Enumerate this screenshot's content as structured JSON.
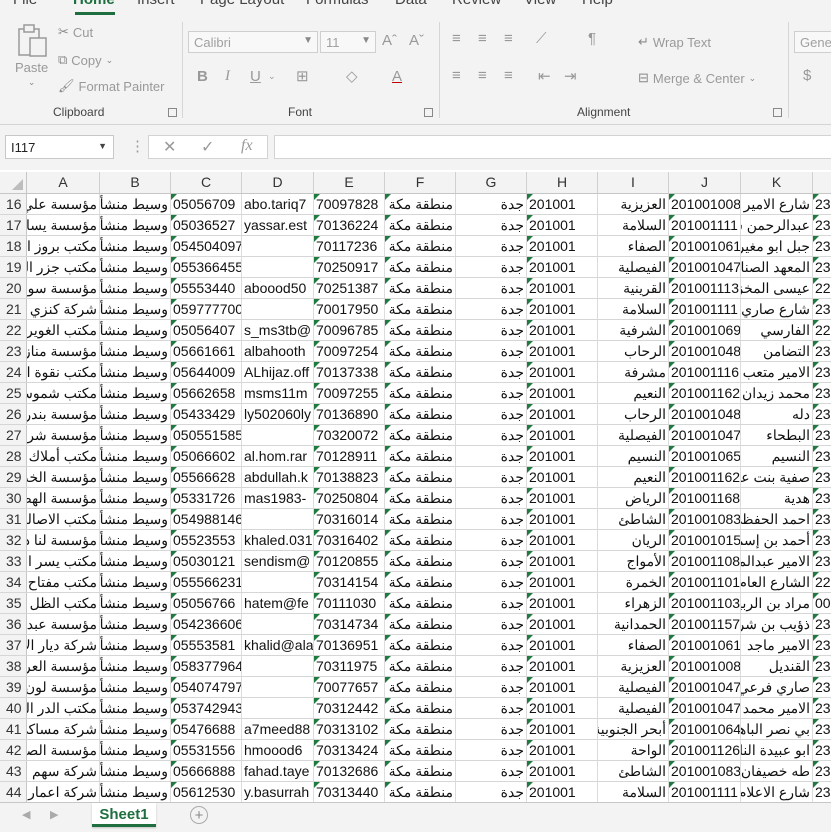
{
  "ribbon_tabs": [
    "File",
    "Home",
    "Insert",
    "Page Layout",
    "Formulas",
    "Data",
    "Review",
    "View",
    "Help"
  ],
  "clipboard": {
    "paste": "Paste",
    "cut": "Cut",
    "copy": "Copy",
    "format_painter": "Format Painter",
    "label": "Clipboard"
  },
  "font": {
    "name": "Calibri",
    "size": "11",
    "label": "Font",
    "bold": "B",
    "italic": "I",
    "underline": "U",
    "grow": "Aˆ",
    "shrink": "Aˇ",
    "font_color": "A"
  },
  "alignment": {
    "wrap_text": "Wrap Text",
    "merge_center": "Merge & Center",
    "label": "Alignment"
  },
  "number": {
    "format": "Gene",
    "currency": "$"
  },
  "name_box": "I117",
  "formula_fx": "fx",
  "columns": [
    "A",
    "B",
    "C",
    "D",
    "E",
    "F",
    "G",
    "H",
    "I",
    "J",
    "K"
  ],
  "rows": [
    {
      "num": "16",
      "a": "مؤسسة علي",
      "b": "وسيط منشأة",
      "c": "05056709",
      "d": "abo.tariq7",
      "e": "70097828",
      "f": "منطقة مكة الـ",
      "g": "جدة",
      "h": "201001",
      "i": "العزيزية",
      "j": "201001008",
      "k": "شارع الامير م",
      "l": "23"
    },
    {
      "num": "17",
      "a": "مؤسسة يسار",
      "b": "وسيط منشأة",
      "c": "05036527",
      "d": "yassar.est",
      "e": "70136224",
      "f": "منطقة مكة الـ",
      "g": "جدة",
      "h": "201001",
      "i": "السلامة",
      "j": "201001111",
      "k": "عبدالرحمن ش",
      "l": "23"
    },
    {
      "num": "18",
      "a": "مكتب بروز الـ",
      "b": "وسيط منشأة",
      "c": "0545040973",
      "d": "",
      "e": "70117236",
      "f": "منطقة مكة الـ",
      "g": "جدة",
      "h": "201001",
      "i": "الصفاء",
      "j": "201001061",
      "k": "جبل ابو مغير",
      "l": "23"
    },
    {
      "num": "19",
      "a": "مكتب جزر الـ",
      "b": "وسيط منشأة",
      "c": "0553664552",
      "d": "",
      "e": "70250917",
      "f": "منطقة مكة الـ",
      "g": "جدة",
      "h": "201001",
      "i": "الفيصلية",
      "j": "201001047",
      "k": "المعهد الصنا",
      "l": "23"
    },
    {
      "num": "20",
      "a": "مؤسسة سواء",
      "b": "وسيط منشأة",
      "c": "05553440",
      "d": "aboood50",
      "e": "70251387",
      "f": "منطقة مكة الـ",
      "g": "جدة",
      "h": "201001",
      "i": "القرينية",
      "j": "201001113",
      "k": "عيسى المخزو",
      "l": "22"
    },
    {
      "num": "21",
      "a": "شركة كنزي الـ",
      "b": "وسيط منشأة",
      "c": "0597777008",
      "d": "",
      "e": "70017950",
      "f": "منطقة مكة الـ",
      "g": "جدة",
      "h": "201001",
      "i": "السلامة",
      "j": "201001111",
      "k": "شارع صاري",
      "l": "23"
    },
    {
      "num": "22",
      "a": "مكتب الغويري",
      "b": "وسيط منشأة",
      "c": "05056407",
      "d": "s_ms3tb@",
      "e": "70096785",
      "f": "منطقة مكة الـ",
      "g": "جدة",
      "h": "201001",
      "i": "الشرفية",
      "j": "201001069",
      "k": "الفارسي",
      "l": "22"
    },
    {
      "num": "23",
      "a": "مؤسسة منازل",
      "b": "وسيط منشأة",
      "c": "05661661",
      "d": "albahooth",
      "e": "70097254",
      "f": "منطقة مكة الـ",
      "g": "جدة",
      "h": "201001",
      "i": "الرحاب",
      "j": "201001048",
      "k": "التضامن",
      "l": "23"
    },
    {
      "num": "24",
      "a": "مكتب نقوة الـ",
      "b": "وسيط منشأة",
      "c": "05644009",
      "d": "ALhijaz.off",
      "e": "70137338",
      "f": "منطقة مكة الـ",
      "g": "جدة",
      "h": "201001",
      "i": "مشرفة",
      "j": "201001116",
      "k": "الامير متعب",
      "l": "23"
    },
    {
      "num": "25",
      "a": "مكتب شموس",
      "b": "وسيط منشأة",
      "c": "05662658",
      "d": "msms11m",
      "e": "70097255",
      "f": "منطقة مكة الـ",
      "g": "جدة",
      "h": "201001",
      "i": "النعيم",
      "j": "201001162",
      "k": "محمد زيدان",
      "l": "23"
    },
    {
      "num": "26",
      "a": "مؤسسة بندر",
      "b": "وسيط منشأة",
      "c": "05433429",
      "d": "ly502060ly",
      "e": "70136890",
      "f": "منطقة مكة الـ",
      "g": "جدة",
      "h": "201001",
      "i": "الرحاب",
      "j": "201001048",
      "k": "دله",
      "l": "23"
    },
    {
      "num": "27",
      "a": "مؤسسة شرق",
      "b": "وسيط منشأة",
      "c": "0505515851",
      "d": "",
      "e": "70320072",
      "f": "منطقة مكة الـ",
      "g": "جدة",
      "h": "201001",
      "i": "الفيصلية",
      "j": "201001047",
      "k": "البطحاء",
      "l": "23"
    },
    {
      "num": "28",
      "a": "مكتب أملاك",
      "b": "وسيط منشأة",
      "c": "05066602",
      "d": "al.hom.rar",
      "e": "70128911",
      "f": "منطقة مكة الـ",
      "g": "جدة",
      "h": "201001",
      "i": "النسيم",
      "j": "201001065",
      "k": "النسيم",
      "l": "23"
    },
    {
      "num": "29",
      "a": "مؤسسة الخد",
      "b": "وسيط منشأة",
      "c": "05566628",
      "d": "abdullah.k",
      "e": "70138823",
      "f": "منطقة مكة الـ",
      "g": "جدة",
      "h": "201001",
      "i": "النعيم",
      "j": "201001162",
      "k": "صفية بنت عـ",
      "l": "23"
    },
    {
      "num": "30",
      "a": "مؤسسة الهض",
      "b": "وسيط منشأة",
      "c": "05331726",
      "d": "mas1983-",
      "e": "70250804",
      "f": "منطقة مكة الـ",
      "g": "جدة",
      "h": "201001",
      "i": "الرياض",
      "j": "201001168",
      "k": "هدية",
      "l": "23"
    },
    {
      "num": "31",
      "a": "مكتب الاصالـ",
      "b": "وسيط منشأة",
      "c": "0549881463",
      "d": "",
      "e": "70316014",
      "f": "منطقة مكة الـ",
      "g": "جدة",
      "h": "201001",
      "i": "الشاطئ",
      "j": "201001083",
      "k": "احمد الحفظي",
      "l": "23"
    },
    {
      "num": "32",
      "a": "مؤسسة لنا دا",
      "b": "وسيط منشأة",
      "c": "05523553",
      "d": "khaled.031",
      "e": "70316402",
      "f": "منطقة مكة الـ",
      "g": "جدة",
      "h": "201001",
      "i": "الريان",
      "j": "201001015",
      "k": "أحمد بن إسم",
      "l": "23"
    },
    {
      "num": "33",
      "a": "مكتب يسر الـ",
      "b": "وسيط منشأة",
      "c": "05030121",
      "d": "sendism@",
      "e": "70120855",
      "f": "منطقة مكة الـ",
      "g": "جدة",
      "h": "201001",
      "i": "الأمواج",
      "j": "201001108",
      "k": "الامير عبدالمـ",
      "l": "23"
    },
    {
      "num": "34",
      "a": "مكتب مفتاح",
      "b": "وسيط منشأة",
      "c": "0555662313",
      "d": "",
      "e": "70314154",
      "f": "منطقة مكة الـ",
      "g": "جدة",
      "h": "201001",
      "i": "الخمرة",
      "j": "201001101",
      "k": "الشارع العام",
      "l": "22"
    },
    {
      "num": "35",
      "a": "مكتب الظل ل",
      "b": "وسيط منشأة",
      "c": "05056766",
      "d": "hatem@fe",
      "e": "70111030",
      "f": "منطقة مكة الـ",
      "g": "جدة",
      "h": "201001",
      "i": "الزهراء",
      "j": "201001103",
      "k": "مراد بن الربيع",
      "l": "00"
    },
    {
      "num": "36",
      "a": "مؤسسة عبدا",
      "b": "وسيط منشأة",
      "c": "0542366064",
      "d": "",
      "e": "70314734",
      "f": "منطقة مكة الـ",
      "g": "جدة",
      "h": "201001",
      "i": "الحمدانية",
      "j": "201001157",
      "k": "ذؤيب بن شرية",
      "l": "23"
    },
    {
      "num": "37",
      "a": "شركة ديار الا",
      "b": "وسيط منشأة",
      "c": "05553581",
      "d": "khalid@ala",
      "e": "70136951",
      "f": "منطقة مكة الـ",
      "g": "جدة",
      "h": "201001",
      "i": "الصفاء",
      "j": "201001061",
      "k": "الامير ماجد",
      "l": "23"
    },
    {
      "num": "38",
      "a": "مؤسسة العرو",
      "b": "وسيط منشأة",
      "c": "0583779647",
      "d": "",
      "e": "70311975",
      "f": "منطقة مكة الـ",
      "g": "جدة",
      "h": "201001",
      "i": "العزيزية",
      "j": "201001008",
      "k": "القنديل",
      "l": "23"
    },
    {
      "num": "39",
      "a": "مؤسسة لون",
      "b": "وسيط منشأة",
      "c": "0540747970",
      "d": "",
      "e": "70077657",
      "f": "منطقة مكة الـ",
      "g": "جدة",
      "h": "201001",
      "i": "الفيصلية",
      "j": "201001047",
      "k": "صاري فرعي",
      "l": "23"
    },
    {
      "num": "40",
      "a": "مكتب الدر الـ",
      "b": "وسيط منشأة",
      "c": "0537429430",
      "d": "",
      "e": "70312442",
      "f": "منطقة مكة الـ",
      "g": "جدة",
      "h": "201001",
      "i": "الفيصلية",
      "j": "201001047",
      "k": "الامير محمد",
      "l": "23"
    },
    {
      "num": "41",
      "a": "شركة مساكي",
      "b": "وسيط منشأة",
      "c": "05476688",
      "d": "a7meed88",
      "e": "70313102",
      "f": "منطقة مكة الـ",
      "g": "جدة",
      "h": "201001",
      "i": "أبحر الجنوبية",
      "j": "201001064",
      "k": "بي نصر الباها",
      "l": "23"
    },
    {
      "num": "42",
      "a": "مؤسسة الصـ",
      "b": "وسيط منشأة",
      "c": "05531556",
      "d": "hmoood6",
      "e": "70313424",
      "f": "منطقة مكة الـ",
      "g": "جدة",
      "h": "201001",
      "i": "الواحة",
      "j": "201001126",
      "k": "ابو عبيدة النا",
      "l": "23"
    },
    {
      "num": "43",
      "a": "شركة سهم الـ",
      "b": "وسيط منشأة",
      "c": "05666888",
      "d": "fahad.taye",
      "e": "70132686",
      "f": "منطقة مكة الـ",
      "g": "جدة",
      "h": "201001",
      "i": "الشاطئ",
      "j": "201001083",
      "k": "طه خصيفان",
      "l": "23"
    },
    {
      "num": "44",
      "a": "شركة اعمار",
      "b": "وسيط منشأة",
      "c": "05612530",
      "d": "y.basurrah",
      "e": "70313440",
      "f": "منطقة مكة الـ",
      "g": "جدة",
      "h": "201001",
      "i": "السلامة",
      "j": "201001111",
      "k": "شارع الاعلام",
      "l": "23"
    }
  ],
  "sheet_tab": "Sheet1",
  "add_sheet": "+"
}
